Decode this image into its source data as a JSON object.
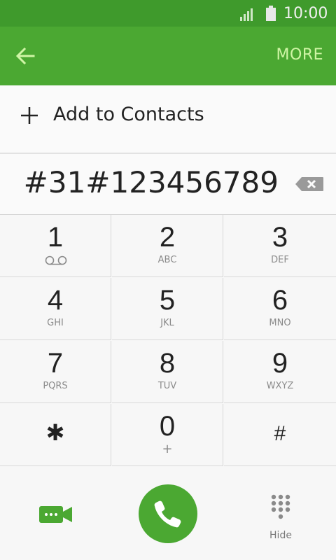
{
  "status": {
    "time": "10:00"
  },
  "appbar": {
    "more_label": "MORE"
  },
  "add_contact": {
    "label": "Add to Contacts"
  },
  "display": {
    "number": "#31#123456789"
  },
  "keys": [
    {
      "digit": "1",
      "letters": ""
    },
    {
      "digit": "2",
      "letters": "ABC"
    },
    {
      "digit": "3",
      "letters": "DEF"
    },
    {
      "digit": "4",
      "letters": "GHI"
    },
    {
      "digit": "5",
      "letters": "JKL"
    },
    {
      "digit": "6",
      "letters": "MNO"
    },
    {
      "digit": "7",
      "letters": "PQRS"
    },
    {
      "digit": "8",
      "letters": "TUV"
    },
    {
      "digit": "9",
      "letters": "WXYZ"
    },
    {
      "digit": "✱",
      "letters": ""
    },
    {
      "digit": "0",
      "letters": "+"
    },
    {
      "digit": "#",
      "letters": ""
    }
  ],
  "bottom": {
    "hide_label": "Hide"
  },
  "colors": {
    "statusbar": "#3f9a2c",
    "appbar": "#4ba832",
    "accent": "#4ba832",
    "more": "#cff5a5"
  }
}
